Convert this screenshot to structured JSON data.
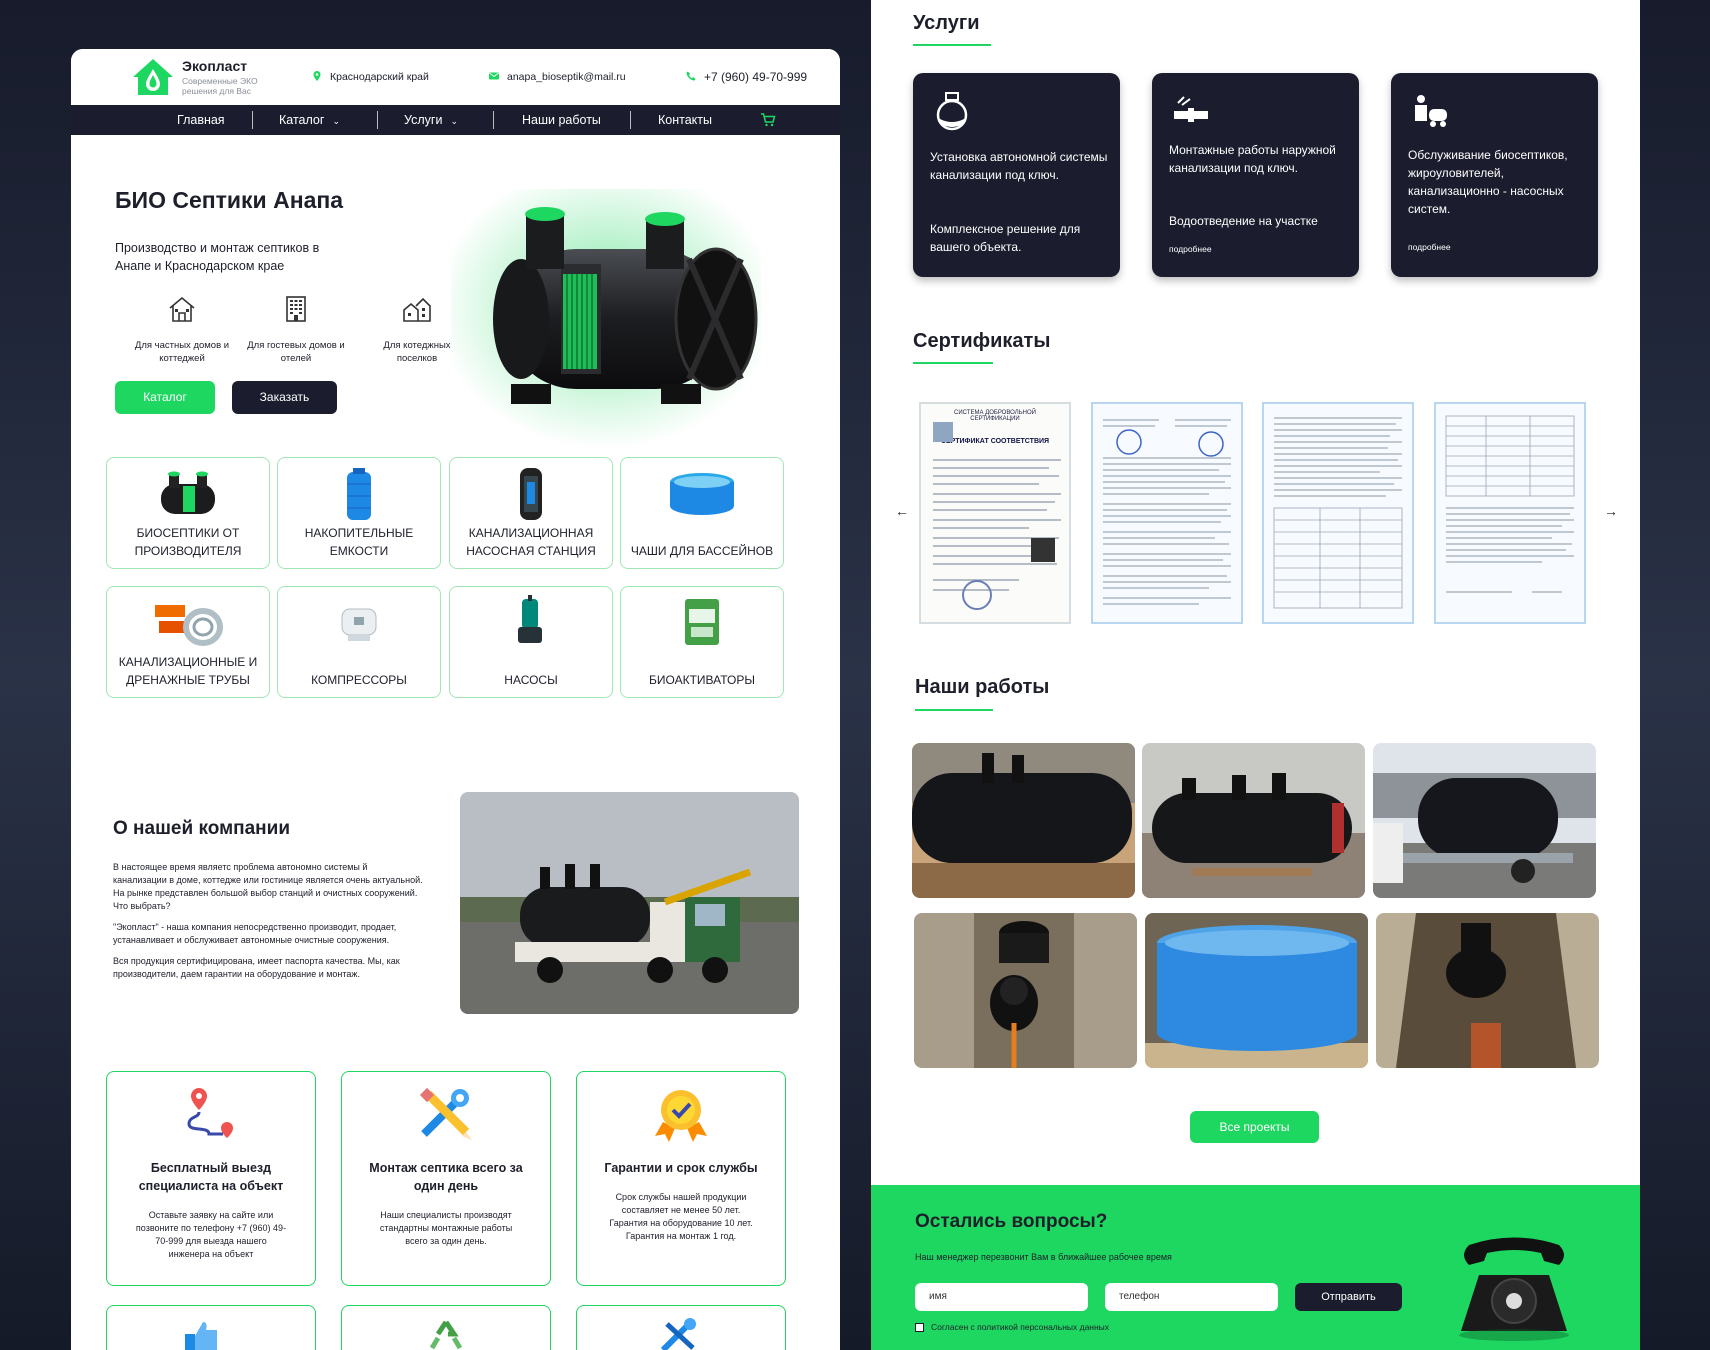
{
  "header": {
    "logo_name": "Экопласт",
    "logo_tagline": "Современные ЭКО решения для Вас",
    "region": "Краснодарский край",
    "email": "anapa_bioseptik@mail.ru",
    "phone": "+7 (960) 49-70-999"
  },
  "nav": {
    "items": [
      {
        "label": "Главная"
      },
      {
        "label": "Каталог"
      },
      {
        "label": "Услуги"
      },
      {
        "label": "Наши работы"
      },
      {
        "label": "Контакты"
      }
    ]
  },
  "hero": {
    "title": "БИО Септики Анапа",
    "subtitle": "Производство и монтаж септиков в Анапе и Краснодарском крае",
    "features": [
      {
        "label": "Для частных домов и коттеджей",
        "icon": "house-icon"
      },
      {
        "label": "Для гостевых домов и отелей",
        "icon": "hotel-icon"
      },
      {
        "label": "Для котеджных поселков",
        "icon": "village-icon"
      }
    ],
    "catalog_button": "Каталог",
    "order_button": "Заказать"
  },
  "categories": [
    {
      "label": "Биосептики от производителя",
      "icon": "septic-tank-icon"
    },
    {
      "label": "Накопительные емкости",
      "icon": "storage-tank-icon"
    },
    {
      "label": "Канализационная насосная станция",
      "icon": "pump-station-icon"
    },
    {
      "label": "Чаши для бассейнов",
      "icon": "pool-bowl-icon"
    },
    {
      "label": "Канализационные и дренажные трубы",
      "icon": "pipes-icon"
    },
    {
      "label": "Компрессоры",
      "icon": "compressor-icon"
    },
    {
      "label": "Насосы",
      "icon": "pump-icon"
    },
    {
      "label": "Биоактиваторы",
      "icon": "bioactivator-icon"
    }
  ],
  "about": {
    "title": "О нашей компании",
    "paragraphs": [
      "В настоящее время являетс  проблема автономно системы й канализации в доме, коттедже или гостинице является очень актуальной. На рынке представлен большой выбор станций и очистных сооружений. Что выбрать?",
      "\"Экопласт\" - наша компания непосредственно производит, продает, устанавливает и обслуживает автономные очистные сооружения.",
      "Вся продукция сертифицирована, имеет паспорта качества. Мы, как производители, даем гарантии на оборудование и монтаж."
    ]
  },
  "benefits": [
    {
      "title": "Бесплатный выезд специалиста на объект",
      "text": "Оставьте заявку на сайте или позвоните по телефону +7 (960) 49-70-999 для выезда нашего инженера на объект",
      "icon": "location-route-icon"
    },
    {
      "title": "Монтаж септика всего за один день",
      "text": "Наши специалисты производят стандартны монтажные  работы всего за один день.",
      "icon": "tools-icon"
    },
    {
      "title": "Гарантии и срок службы",
      "text": "Срок службы нашей продукции составляет не менее 50 лет. Гарантия на оборудование 10 лет. Гарантия на монтаж 1 год.",
      "icon": "quality-badge-icon"
    }
  ],
  "services": {
    "title": "Услуги",
    "cards": [
      {
        "text1": "Установка автономной системы канализации под ключ.",
        "text2": "Комплексное решение для вашего объекта.",
        "more": "",
        "icon": "septic-icon"
      },
      {
        "text1": "Монтажные работы наружной канализации под ключ.",
        "text2": "Водоотведение на участке",
        "more": "подробнее",
        "icon": "pipe-icon"
      },
      {
        "text1": "Обслуживание биосептиков, жироуловителей, канализационно - насосных систем.",
        "text2": "",
        "more": "подробнее",
        "icon": "service-truck-icon"
      }
    ]
  },
  "certificates": {
    "title": "Сертификаты",
    "cert1_heading": "СИСТЕМА ДОБРОВОЛЬНОЙ СЕРТИФИКАЦИИ",
    "cert1_title": "СЕРТИФИКАТ СООТВЕТСТВИЯ"
  },
  "works": {
    "title": "Наши работы",
    "all_button": "Все проекты"
  },
  "contact": {
    "title": "Остались вопросы?",
    "subtitle": "Наш менеджер перезвонит Вам  в ближайшее рабочее время",
    "name_placeholder": "имя",
    "phone_placeholder": "телефон",
    "submit": "Отправить",
    "consent": "Согласен с политикой персональных данных"
  },
  "colors": {
    "accent": "#1ed760",
    "dark": "#1b1d2e"
  }
}
